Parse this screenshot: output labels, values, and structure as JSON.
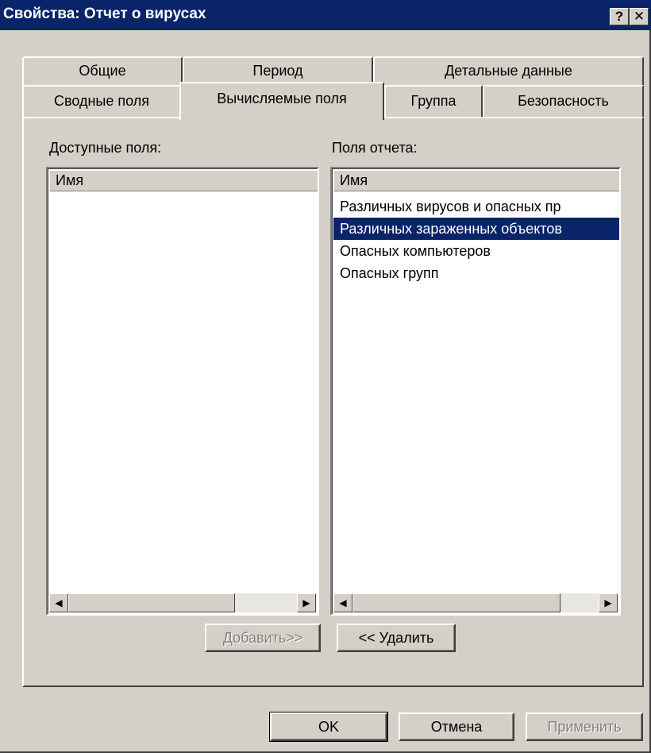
{
  "window": {
    "title": "Свойства: Отчет о вирусах",
    "help_button": "?",
    "close_button": "✕"
  },
  "tabs": {
    "row1": [
      "Общие",
      "Период",
      "Детальные данные"
    ],
    "row2": [
      "Сводные поля",
      "Вычисляемые поля",
      "Группа",
      "Безопасность"
    ],
    "active": "Вычисляемые поля"
  },
  "available": {
    "label": "Доступные поля:",
    "column_header": "Имя",
    "items": []
  },
  "report": {
    "label": "Поля отчета:",
    "column_header": "Имя",
    "items": [
      "Различных вирусов и опасных пр",
      "Различных зараженных объектов",
      "Опасных компьютеров",
      "Опасных групп"
    ],
    "selected_index": 1
  },
  "buttons": {
    "add": "Добавить>>",
    "remove": "<< Удалить",
    "ok": "OK",
    "cancel": "Отмена",
    "apply": "Применить"
  },
  "icons": {
    "scroll_left": "◀",
    "scroll_right": "▶"
  },
  "colors": {
    "titlebar": "#0a246a",
    "selection": "#0a246a",
    "face": "#d4d0c8"
  }
}
